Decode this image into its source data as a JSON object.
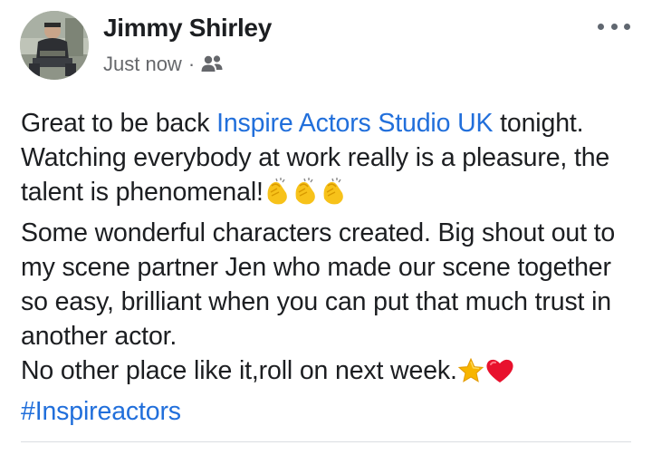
{
  "post": {
    "author": "Jimmy Shirley",
    "timestamp": "Just now",
    "separator": "·",
    "audience_icon": "friends-icon",
    "menu_icon": "more-options-icon",
    "avatar_icon": "profile-avatar",
    "body": {
      "p1_before": "Great to be back ",
      "p1_link": "Inspire Actors Studio UK",
      "p1_after": " tonight. Watching everybody at work really is a pleasure, the talent is phenomenal!",
      "clap_emojis": [
        "clapping-hands",
        "clapping-hands",
        "clapping-hands"
      ],
      "p2": "Some wonderful characters created. Big shout out to my scene partner Jen who made our scene together so easy, brilliant when you can put that much trust in another actor.",
      "p3": "No other place like it,roll on next week.",
      "p3_emojis": [
        "star",
        "red-heart"
      ],
      "hashtag": "#Inspireactors"
    }
  },
  "colors": {
    "link": "#216fdb",
    "text": "#1c1e21",
    "meta": "#65676b",
    "clap": "#f7c21a",
    "star": "#f7b500",
    "heart": "#e8112d"
  }
}
